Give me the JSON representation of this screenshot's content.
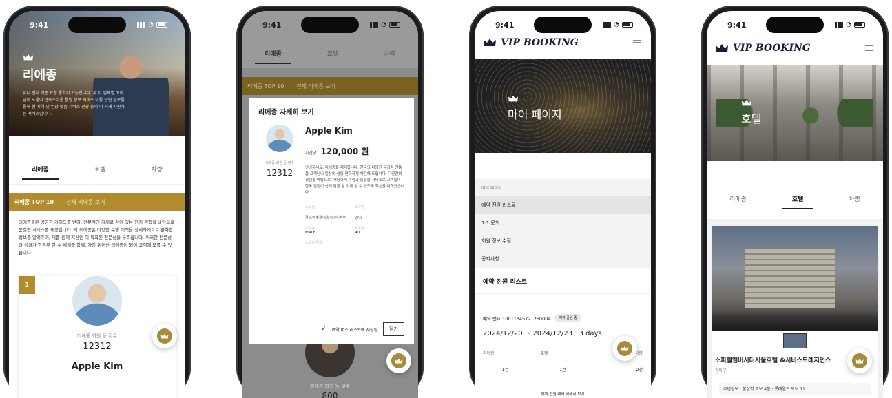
{
  "time": "9:41",
  "colors": {
    "gold": "#b08c2c",
    "dark": "#1b1b1d"
  },
  "phone1": {
    "hero_title": "리에종",
    "hero_desc": "유니 면세 기준 요청 통역이 가능합니다. 우 각 업체별 고객님의 도움이 만족스러운 웰빙 정보 서비스 이름 관련 정보를 통해 함 지역 및 업장 맞춤 서비스 관광 등의 다 거래 지원하는 서비스입니다.",
    "tabs": [
      "리에종",
      "호텔",
      "차량"
    ],
    "gold_tabs": [
      "리에종 TOP 10",
      "전체 리에종 보기"
    ],
    "intro": "리에종들은 성공한 가이드를 받아, 전문적인 자세로 감이 있는 현지 경험을 바탕으로 품질형 서비스를 제공합니다. 각 리에종은 다양한 수행 이력을 상세하게으로 완화한 정보를 알려주며, 제품 원제 지산인 이 특화된 전문성을 구축합니다. 이러한 전문성과 성과가 한정부 한 수 체계를 함께, 가장 뛰어난 리에종이 되어 고객에 모를 수 있습니다.",
    "rank": "1",
    "avatar_label": "리에종 회원 등 횟수",
    "count": "12312",
    "name": "Apple Kim"
  },
  "phone2": {
    "tabs": [
      "리에종",
      "호텔",
      "차량"
    ],
    "gold_tabs": [
      "리에종 TOP 10",
      "전체 리에종 보기"
    ],
    "modal_title": "리에종 자세히 보기",
    "name": "Apple Kim",
    "price_label": "시간당",
    "price": "120,000 원",
    "count_label": "리에종 회원 등 횟수",
    "count": "12312",
    "desc": "안녕하세요, 리에종을 제때합니다. 한국의 다양한 문화적 전통을 고객님이 일상의 생동 편하하게 체감해 드립니다. 다년간의 경험을 바탕으로, 새담하게 여행과 통합을 서비스로 고객들이 한국 일정이 쉽게 편할 뿐 있게 될 수 있도록 최선을 다하겠습니다.",
    "fields": [
      {
        "label": "소유권",
        "value": ""
      },
      {
        "label": "소유권",
        "value": ""
      },
      {
        "label": "경남/부울경/강원/인/속/제주",
        "value": "영어"
      },
      {
        "label": "소유권",
        "value": "MALE"
      },
      {
        "label": "소유권",
        "value": "40"
      },
      {
        "label": "소유권/경력",
        "value": ""
      }
    ],
    "checkbox_label": "예약 버스 리스트에 저장됨",
    "close_label": "닫기",
    "bottom_label": "리에종 회원 등 횟수",
    "bottom_count": "800"
  },
  "phone3": {
    "brand": "VIP BOOKING",
    "hero_title": "마이 페이지",
    "section_label": "마이 페이지",
    "menu": [
      "예약 전원 리스트",
      "1:1 문의",
      "회원 정보 수정",
      "공지사항"
    ],
    "list_title": "예약 전원 리스트",
    "booking_label": "예약 번호 : 0011345721260004",
    "booking_badge": "예약 금원 중",
    "dates": "2024/12/20 ~ 2024/12/23 · 3 days",
    "cols": [
      {
        "label": "리에종",
        "value": "1건"
      },
      {
        "label": "호텔",
        "value": "1건"
      },
      {
        "label": "차량",
        "value": "2건"
      }
    ],
    "footer": "예약 전원 내역 자세히 보기"
  },
  "phone4": {
    "brand": "VIP BOOKING",
    "hero_title": "호텔",
    "tabs": [
      "리에종",
      "호텔",
      "차량"
    ],
    "hotel_name": "소피텔앰버서더서울호텔 &서비스드레지던스",
    "hotel_area": "송파구",
    "info": "주변정보 · 잠실역 도보 4분 · 롯데월드 도보 11"
  }
}
